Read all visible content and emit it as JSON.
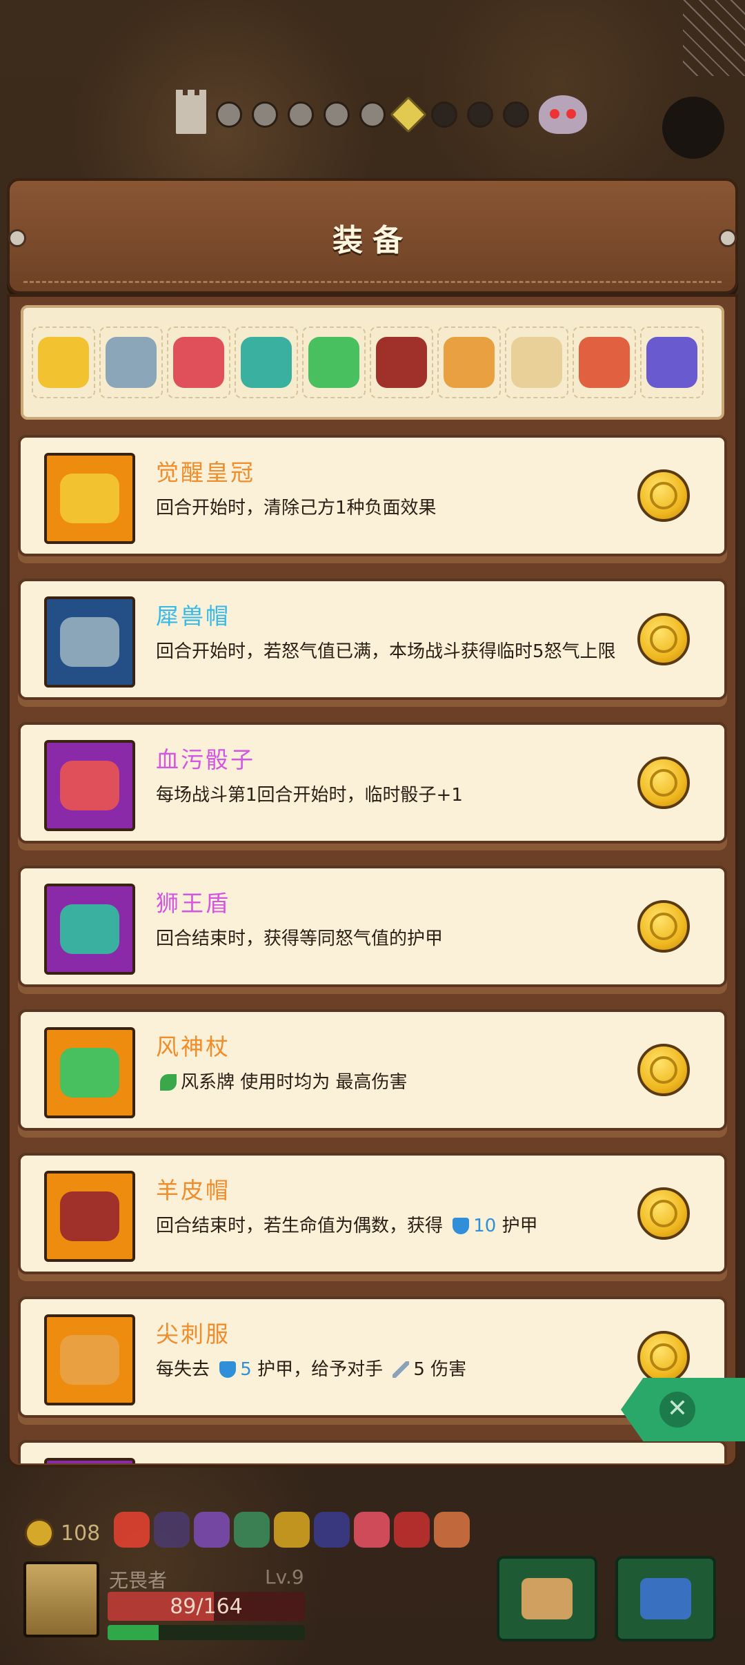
{
  "progress": {
    "done": 5,
    "current": 1,
    "remaining": 3
  },
  "panel": {
    "title": "装备"
  },
  "strip_icons": [
    {
      "name": "crown",
      "color": "#f2c230"
    },
    {
      "name": "rhino-helmet",
      "color": "#8aa6b8"
    },
    {
      "name": "bloody-dice",
      "color": "#e0505a"
    },
    {
      "name": "lion-shield",
      "color": "#3ab0a0"
    },
    {
      "name": "wind-staff",
      "color": "#48c060"
    },
    {
      "name": "sheepskin-hat",
      "color": "#a0302a"
    },
    {
      "name": "spike-armor",
      "color": "#e8a040"
    },
    {
      "name": "scroll",
      "color": "#e8d098"
    },
    {
      "name": "ham",
      "color": "#e06040"
    },
    {
      "name": "ring",
      "color": "#6a5ad0"
    }
  ],
  "items": [
    {
      "name": "觉醒皇冠",
      "name_color": "#f08c2a",
      "box_color": "#ee8c10",
      "art_color": "#f2c230",
      "parts": [
        {
          "t": "回合开始时，清除己方1种负面效果"
        }
      ]
    },
    {
      "name": "犀兽帽",
      "name_color": "#36b8e8",
      "box_color": "#234f86",
      "art_color": "#8aa6b8",
      "parts": [
        {
          "t": "回合开始时，若怒气值已满，本场战斗获得临时5怒气上限"
        }
      ]
    },
    {
      "name": "血污骰子",
      "name_color": "#d455e0",
      "box_color": "#8b2aa8",
      "art_color": "#e0505a",
      "parts": [
        {
          "t": "每场战斗第1回合开始时，临时骰子+1"
        }
      ]
    },
    {
      "name": "狮王盾",
      "name_color": "#d455e0",
      "box_color": "#8b2aa8",
      "art_color": "#3ab0a0",
      "parts": [
        {
          "t": "回合结束时，获得等同怒气值的护甲"
        }
      ]
    },
    {
      "name": "风神杖",
      "name_color": "#f08c2a",
      "box_color": "#ee8c10",
      "art_color": "#48c060",
      "parts": [
        {
          "icon": "leaf-icon"
        },
        {
          "t": "风系牌 使用时均为 最高伤害"
        }
      ]
    },
    {
      "name": "羊皮帽",
      "name_color": "#f08c2a",
      "box_color": "#ee8c10",
      "art_color": "#a0302a",
      "parts": [
        {
          "t": "回合结束时，若生命值为偶数，获得 "
        },
        {
          "icon": "shield-icon"
        },
        {
          "t": "10",
          "cls": "blue"
        },
        {
          "t": " 护甲"
        }
      ]
    },
    {
      "name": "尖刺服",
      "name_color": "#f08c2a",
      "box_color": "#ee8c10",
      "art_color": "#e8a040",
      "parts": [
        {
          "t": "每失去 "
        },
        {
          "icon": "shield-icon"
        },
        {
          "t": "5",
          "cls": "blue"
        },
        {
          "t": " 护甲，给予对手 "
        },
        {
          "icon": "sword-icon"
        },
        {
          "t": "5 伤害"
        }
      ]
    },
    {
      "name": "",
      "name_color": "#d455e0",
      "box_color": "#8b2aa8",
      "art_color": "#8b2aa8",
      "parts": []
    }
  ],
  "player": {
    "coins": "108",
    "name": "无畏者",
    "level": "Lv.9",
    "hp": "89/164",
    "hp_fraction": 0.54,
    "xp_fraction": 0.26
  },
  "relics": [
    "#e04030",
    "#4a3a6a",
    "#7a4ab0",
    "#3a8a5a",
    "#d0a020",
    "#3a3a8a",
    "#e05060",
    "#c03030",
    "#d07040"
  ],
  "bottom_buttons": [
    {
      "name": "viking-helmet-button",
      "color": "#d0a060"
    },
    {
      "name": "cards-button",
      "color": "#3a70c0"
    }
  ]
}
